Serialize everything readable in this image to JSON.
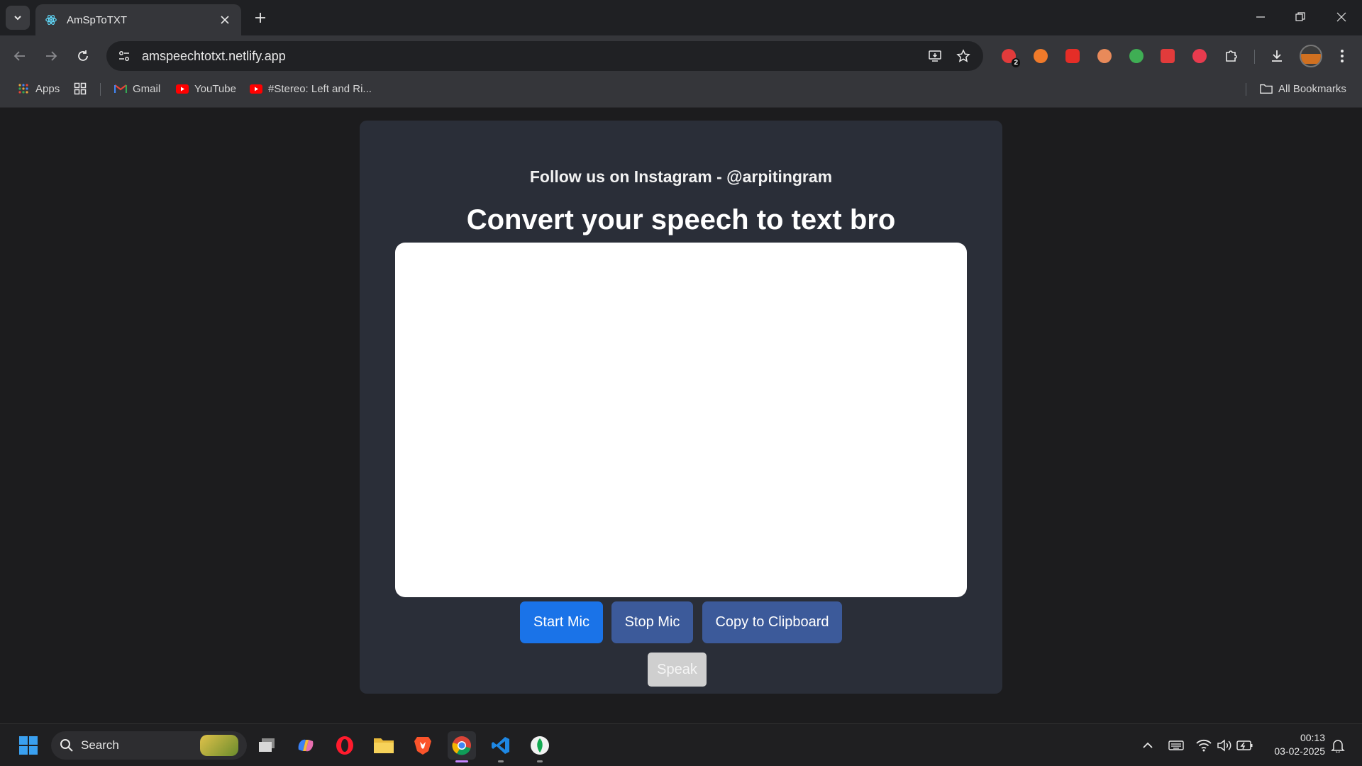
{
  "browser": {
    "tab": {
      "title": "AmSpToTXT"
    },
    "url": "amspeechtotxt.netlify.app",
    "extensions": [
      {
        "icon": "extension-red-icon",
        "color": "#e23b3b",
        "badge": "2"
      },
      {
        "icon": "extension-orange-icon",
        "color": "#f07a2a",
        "badge": ""
      },
      {
        "icon": "extension-youtube-red-icon",
        "color": "#e52d27",
        "badge": ""
      },
      {
        "icon": "extension-cookie-icon",
        "color": "#e88a5a",
        "badge": ""
      },
      {
        "icon": "extension-green-icon",
        "color": "#3fae54",
        "badge": ""
      },
      {
        "icon": "extension-red-square-icon",
        "color": "#e23b3b",
        "badge": ""
      },
      {
        "icon": "extension-infinity-icon",
        "color": "#e83b4e",
        "badge": ""
      }
    ],
    "bookmarks": {
      "apps": "Apps",
      "gmail": "Gmail",
      "youtube": "YouTube",
      "stereo": "#Stereo: Left and Ri...",
      "all": "All Bookmarks"
    }
  },
  "page": {
    "follow_text": "Follow us on Instagram - @arpitingram",
    "heading": "Convert your speech to text bro",
    "textarea_value": "",
    "buttons": {
      "start": "Start Mic",
      "stop": "Stop Mic",
      "copy": "Copy to Clipboard",
      "speak": "Speak"
    }
  },
  "taskbar": {
    "search_label": "Search",
    "time": "00:13",
    "date": "03-02-2025"
  },
  "colors": {
    "card_bg": "#2a2e38",
    "start_button": "#1a73e8",
    "secondary_button": "#3c5a9a",
    "speak_button_disabled": "#cfcfcf"
  }
}
